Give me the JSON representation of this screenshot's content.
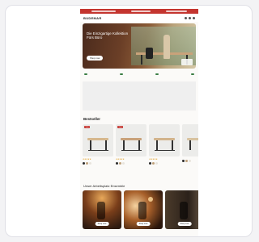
{
  "store": {
    "logo": "BUDEMAR",
    "promo_items": [
      "",
      "",
      ""
    ]
  },
  "hero": {
    "title": "Die Einzigartige Kollektion Fürs Büro",
    "subtitle": "",
    "button": "Shop now",
    "badge": ""
  },
  "usps": [
    "",
    "",
    "",
    ""
  ],
  "testimonial": {
    "quote": "",
    "press": [
      "",
      "",
      ""
    ]
  },
  "bestsellers": {
    "title": "Bestseller",
    "filters": [
      "",
      ""
    ],
    "products": [
      {
        "tag": "Sale",
        "name": "",
        "price": "",
        "stars": "★★★★★",
        "top": "#d6b88e",
        "swatches": [
          "#2b2b2b",
          "#bfa17a",
          "#e8e4dc"
        ]
      },
      {
        "tag": "Sale",
        "name": "",
        "price": "",
        "stars": "★★★★★",
        "top": "#c9a27a",
        "swatches": [
          "#2b2b2b",
          "#bfa17a",
          "#e8e4dc"
        ]
      },
      {
        "tag": "",
        "name": "",
        "price": "",
        "stars": "★★★★★",
        "top": "#d2b48c",
        "swatches": [
          "#2b2b2b",
          "#bfa17a",
          "#e8e4dc"
        ]
      },
      {
        "tag": "",
        "name": "",
        "price": "",
        "stars": "",
        "top": "#d8c3a0",
        "swatches": [
          "#2b2b2b",
          "#bfa17a",
          "#e8e4dc"
        ]
      }
    ]
  },
  "ambience": {
    "title": "Unser Arbeitsplatz Ensemble",
    "items": [
      {
        "button": "Shop now"
      },
      {
        "button": "Shop now"
      },
      {
        "button": "Shop now"
      }
    ]
  }
}
